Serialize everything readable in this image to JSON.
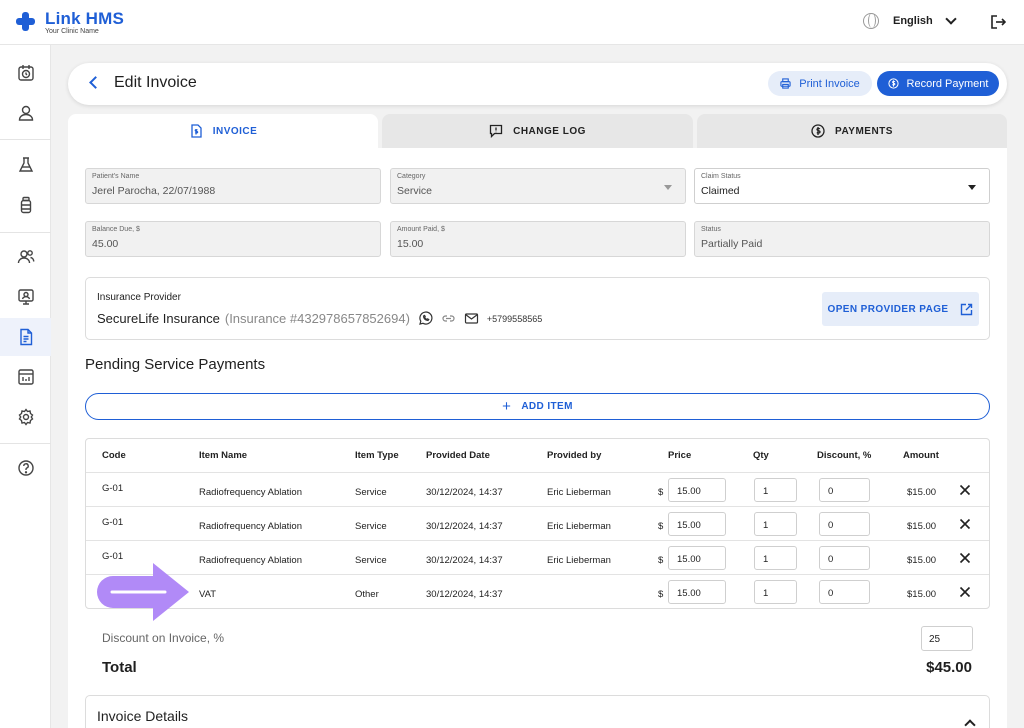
{
  "app": {
    "name": "Link HMS",
    "subtitle": "Your Clinic Name",
    "language": "English"
  },
  "sidebar": {
    "icons": [
      "calendar-clock-icon",
      "user-icon",
      "flask-icon",
      "bottle-icon",
      "users-icon",
      "monitor-user-icon",
      "invoice-icon",
      "report-icon",
      "settings-icon",
      "help-icon"
    ],
    "active": "invoice-icon"
  },
  "header": {
    "title": "Edit Invoice",
    "print_label": "Print Invoice",
    "record_label": "Record Payment"
  },
  "tabs": [
    {
      "label": "INVOICE",
      "icon": "invoice-icon",
      "active": true
    },
    {
      "label": "CHANGE LOG",
      "icon": "comment-alert-icon",
      "active": false
    },
    {
      "label": "PAYMENTS",
      "icon": "dollar-circle-icon",
      "active": false
    }
  ],
  "fields": {
    "patient": {
      "label": "Patient's Name",
      "value": "Jerel Parocha, 22/07/1988"
    },
    "category": {
      "label": "Category",
      "value": "Service"
    },
    "claim_status": {
      "label": "Claim Status",
      "value": "Claimed"
    },
    "balance_due": {
      "label": "Balance Due, $",
      "value": "45.00"
    },
    "amount_paid": {
      "label": "Amount Paid, $",
      "value": "15.00"
    },
    "status": {
      "label": "Status",
      "value": "Partially Paid"
    }
  },
  "insurance": {
    "label": "Insurance Provider",
    "name": "SecureLife Insurance",
    "number": "(Insurance #432978657852694)",
    "phone": "+5799558565",
    "open_label": "OPEN PROVIDER PAGE"
  },
  "pending": {
    "title": "Pending Service Payments",
    "add_label": "ADD ITEM",
    "columns": [
      "Code",
      "Item Name",
      "Item Type",
      "Provided Date",
      "Provided by",
      "Price",
      "Qty",
      "Discount, %",
      "Amount"
    ],
    "currency": "$",
    "rows": [
      {
        "code": "G-01",
        "name": "Radiofrequency Ablation",
        "type": "Service",
        "date": "30/12/2024, 14:37",
        "by": "Eric Lieberman",
        "price": "15.00",
        "qty": "1",
        "discount": "0",
        "amount": "$15.00"
      },
      {
        "code": "G-01",
        "name": "Radiofrequency Ablation",
        "type": "Service",
        "date": "30/12/2024, 14:37",
        "by": "Eric Lieberman",
        "price": "15.00",
        "qty": "1",
        "discount": "0",
        "amount": "$15.00"
      },
      {
        "code": "G-01",
        "name": "Radiofrequency Ablation",
        "type": "Service",
        "date": "30/12/2024, 14:37",
        "by": "Eric Lieberman",
        "price": "15.00",
        "qty": "1",
        "discount": "0",
        "amount": "$15.00"
      },
      {
        "code": "",
        "name": "VAT",
        "type": "Other",
        "date": "30/12/2024, 14:37",
        "by": "",
        "price": "15.00",
        "qty": "1",
        "discount": "0",
        "amount": "$15.00"
      }
    ]
  },
  "summary": {
    "discount_label": "Discount on Invoice, %",
    "discount_value": "25",
    "total_label": "Total",
    "total_value": "$45.00"
  },
  "details": {
    "title": "Invoice Details"
  },
  "colors": {
    "accent": "#1f5fd6",
    "accent_light": "#e6edf9",
    "annotation_arrow": "#b18af7"
  }
}
